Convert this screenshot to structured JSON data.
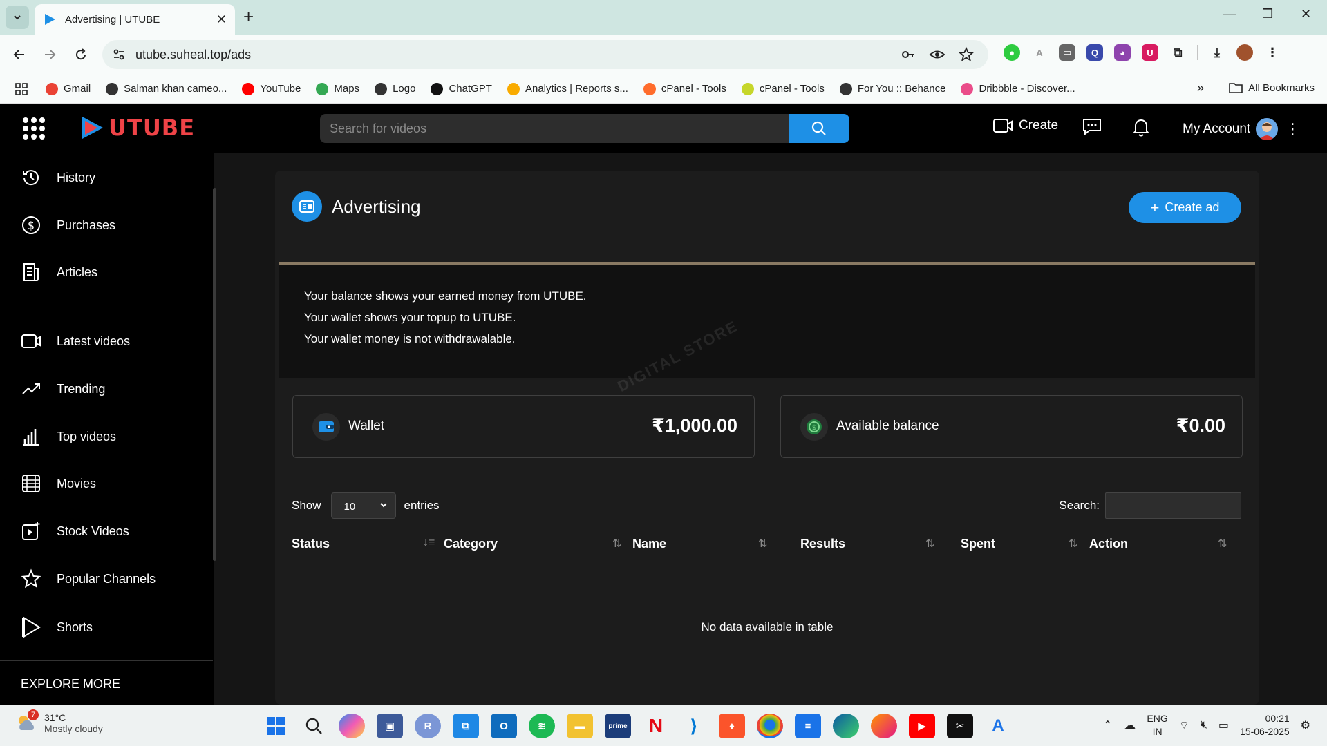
{
  "browser": {
    "tab_title": "Advertising | UTUBE",
    "url": "utube.suheal.top/ads",
    "bookmarks": [
      {
        "label": "Gmail",
        "color": "#ea4335"
      },
      {
        "label": "Salman khan cameo...",
        "color": "#333333"
      },
      {
        "label": "YouTube",
        "color": "#ff0000"
      },
      {
        "label": "Maps",
        "color": "#34a853"
      },
      {
        "label": "Logo",
        "color": "#333333"
      },
      {
        "label": "ChatGPT",
        "color": "#111111"
      },
      {
        "label": "Analytics | Reports s...",
        "color": "#f9ab00"
      },
      {
        "label": "cPanel - Tools",
        "color": "#ff6c2c"
      },
      {
        "label": "cPanel - Tools",
        "color": "#c6d62a"
      },
      {
        "label": "For You :: Behance",
        "color": "#333333"
      },
      {
        "label": "Dribbble - Discover...",
        "color": "#ea4c89"
      }
    ],
    "all_bookmarks": "All Bookmarks"
  },
  "app": {
    "logo": "UTUBE",
    "search_placeholder": "Search for videos",
    "create_label": "Create",
    "account_label": "My Account"
  },
  "sidebar": {
    "items_top": [
      {
        "label": "History",
        "icon": "history-icon"
      },
      {
        "label": "Purchases",
        "icon": "dollar-icon"
      },
      {
        "label": "Articles",
        "icon": "articles-icon"
      }
    ],
    "items_main": [
      {
        "label": "Latest videos",
        "icon": "video-camera-icon"
      },
      {
        "label": "Trending",
        "icon": "trending-icon"
      },
      {
        "label": "Top videos",
        "icon": "bar-chart-icon"
      },
      {
        "label": "Movies",
        "icon": "film-icon"
      },
      {
        "label": "Stock Videos",
        "icon": "stock-video-icon"
      },
      {
        "label": "Popular Channels",
        "icon": "star-icon"
      },
      {
        "label": "Shorts",
        "icon": "shorts-icon"
      }
    ],
    "explore_more": "EXPLORE MORE"
  },
  "main": {
    "title": "Advertising",
    "create_ad": "Create ad",
    "info": [
      "Your balance shows your earned money from UTUBE.",
      "Your wallet shows your topup to UTUBE.",
      "Your wallet money is not withdrawalable."
    ],
    "watermark": "DIGITAL STORE",
    "wallet": {
      "label": "Wallet",
      "value": "₹1,000.00"
    },
    "balance": {
      "label": "Available balance",
      "value": "₹0.00"
    },
    "show_label": "Show",
    "entries_value": "10",
    "entries_label": "entries",
    "search_label": "Search:",
    "columns": [
      "Status",
      "Category",
      "Name",
      "Results",
      "Spent",
      "Action"
    ],
    "empty_text": "No data available in table"
  },
  "taskbar": {
    "temperature": "31°C",
    "weather": "Mostly cloudy",
    "weather_badge": "7",
    "lang_line1": "ENG",
    "lang_line2": "IN",
    "time": "00:21",
    "date": "15-06-2025"
  },
  "colors": {
    "accent": "#1e90e6",
    "logo_red": "#ef4347",
    "info_border": "#8a7a63"
  }
}
